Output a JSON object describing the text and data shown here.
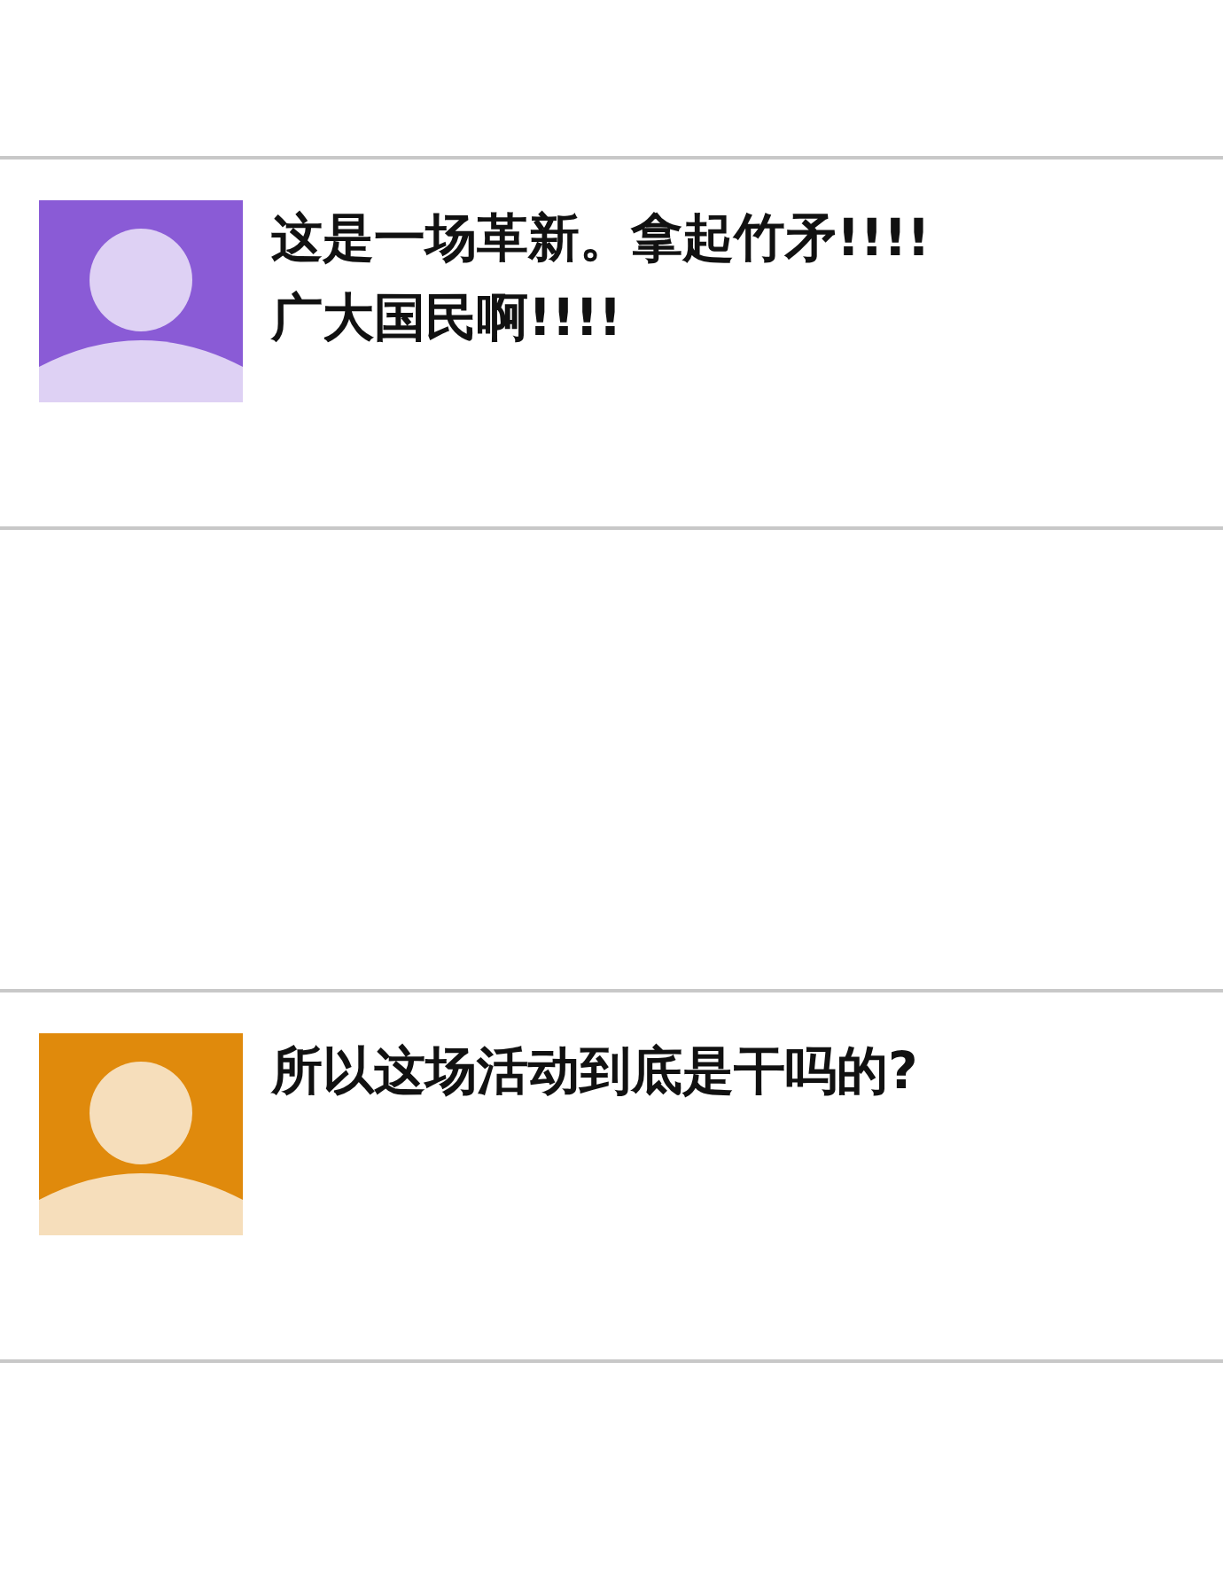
{
  "rows": [
    {
      "kind": "blank"
    },
    {
      "kind": "message",
      "color": "#8a5bd6",
      "lines": [
        "这是一场革新。拿起竹矛!!!!",
        "广大国民啊!!!!"
      ]
    },
    {
      "kind": "blank"
    },
    {
      "kind": "message",
      "color": "#e08a0c",
      "lines": [
        "所以这场活动到底是干吗的?"
      ]
    },
    {
      "kind": "blank"
    }
  ]
}
